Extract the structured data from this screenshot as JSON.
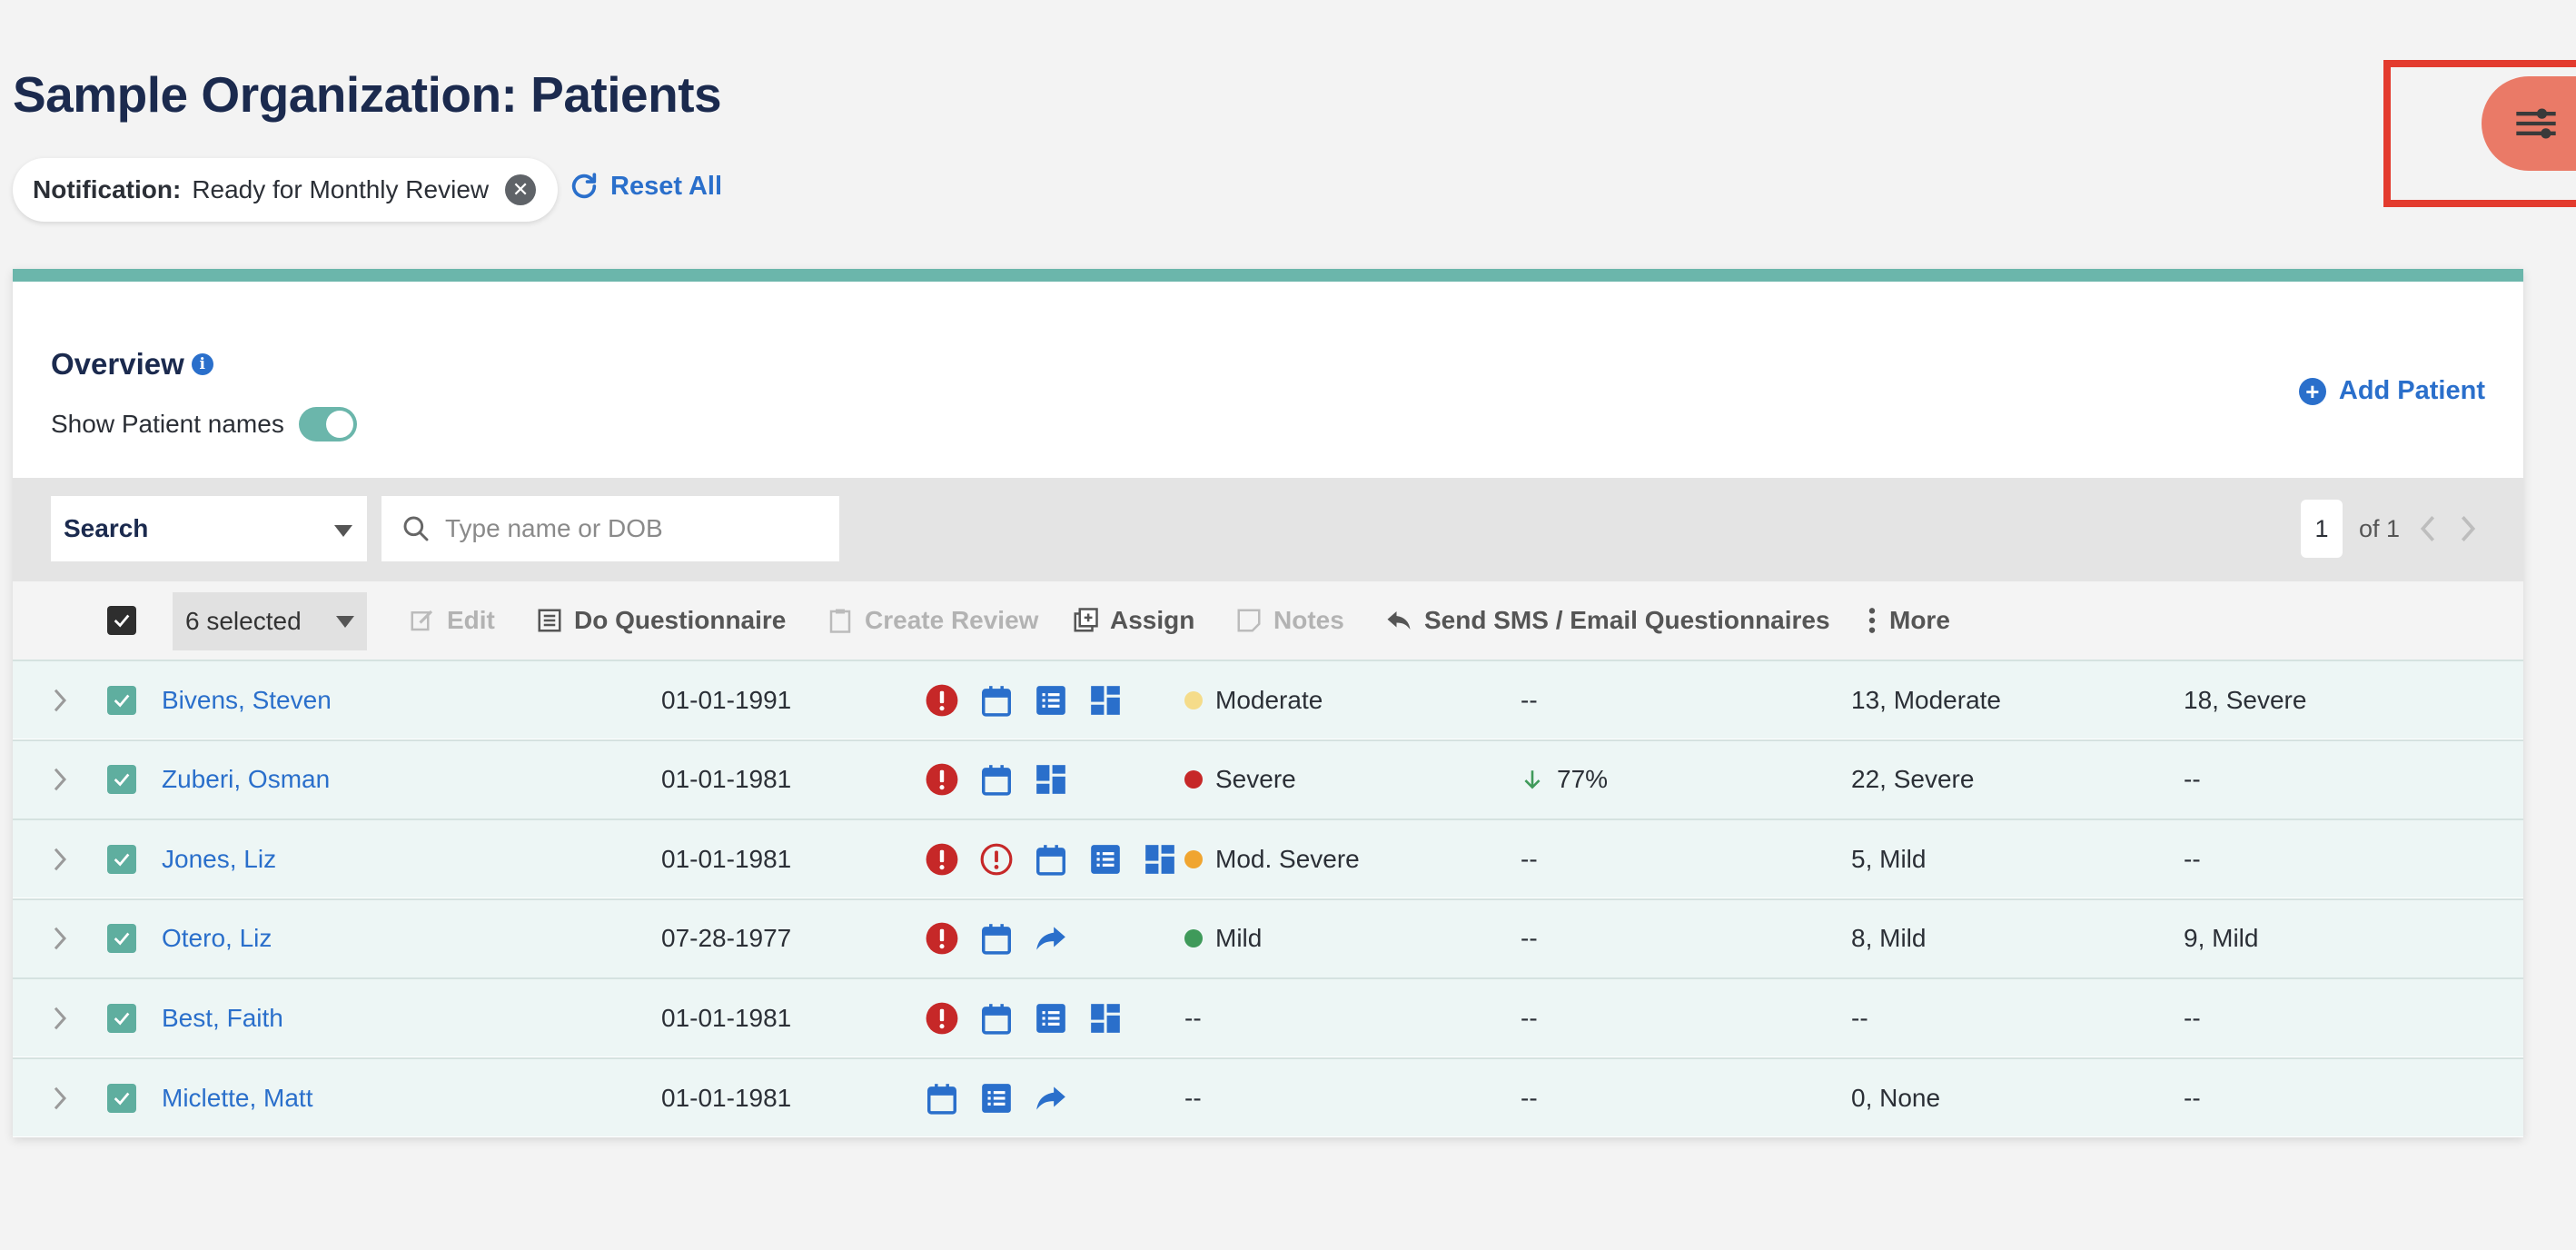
{
  "page": {
    "title": "Sample Organization: Patients"
  },
  "filter": {
    "key": "Notification:",
    "value": "Ready for Monthly Review"
  },
  "reset_label": "Reset All",
  "overview": {
    "title": "Overview",
    "info_glyph": "i",
    "toggle_label": "Show Patient names",
    "toggle_on": true,
    "add_patient_label": "Add Patient"
  },
  "search": {
    "mode": "Search",
    "placeholder": "Type name or DOB"
  },
  "pagination": {
    "current": "1",
    "of_label": "of 1"
  },
  "actions": {
    "selected_label": "6 selected",
    "edit": "Edit",
    "do_questionnaire": "Do Questionnaire",
    "create_review": "Create Review",
    "assign": "Assign",
    "notes": "Notes",
    "send": "Send SMS / Email Questionnaires",
    "more": "More"
  },
  "colors": {
    "accent": "#2a6fcb",
    "teal": "#6bb6ab",
    "alert_red": "#c62828",
    "fab": "#ea7a67",
    "highlight": "#e33b2e",
    "moderate": "#f5dc8a",
    "severe": "#c62828",
    "mod_severe": "#f0a530",
    "mild": "#3f9a5a"
  },
  "rows": [
    {
      "name": "Bivens, Steven",
      "dob": "01-01-1991",
      "icons": [
        "alert-icon",
        "calendar-icon",
        "list-icon",
        "dashboard-icon"
      ],
      "severity": "Moderate",
      "severity_color": "#f5dc8a",
      "change": "--",
      "change_arrow": false,
      "score1": "13, Moderate",
      "score2": "18, Severe"
    },
    {
      "name": "Zuberi, Osman",
      "dob": "01-01-1981",
      "icons": [
        "alert-icon",
        "calendar-icon",
        "dashboard-icon"
      ],
      "severity": "Severe",
      "severity_color": "#c62828",
      "change": "77%",
      "change_arrow": true,
      "score1": "22, Severe",
      "score2": "--"
    },
    {
      "name": "Jones, Liz",
      "dob": "01-01-1981",
      "icons": [
        "alert-icon",
        "alert-outline-icon",
        "calendar-icon",
        "list-icon",
        "dashboard-icon"
      ],
      "severity": "Mod. Severe",
      "severity_color": "#f0a530",
      "change": "--",
      "change_arrow": false,
      "score1": "5, Mild",
      "score2": "--"
    },
    {
      "name": "Otero, Liz",
      "dob": "07-28-1977",
      "icons": [
        "alert-icon",
        "calendar-icon",
        "share-icon"
      ],
      "severity": "Mild",
      "severity_color": "#3f9a5a",
      "change": "--",
      "change_arrow": false,
      "score1": "8, Mild",
      "score2": "9, Mild"
    },
    {
      "name": "Best, Faith",
      "dob": "01-01-1981",
      "icons": [
        "alert-icon",
        "calendar-icon",
        "list-icon",
        "dashboard-icon"
      ],
      "severity": "--",
      "severity_color": null,
      "change": "--",
      "change_arrow": false,
      "score1": "--",
      "score2": "--"
    },
    {
      "name": "Miclette, Matt",
      "dob": "01-01-1981",
      "icons": [
        "calendar-icon",
        "list-icon",
        "share-icon"
      ],
      "severity": "--",
      "severity_color": null,
      "change": "--",
      "change_arrow": false,
      "score1": "0, None",
      "score2": "--"
    }
  ]
}
